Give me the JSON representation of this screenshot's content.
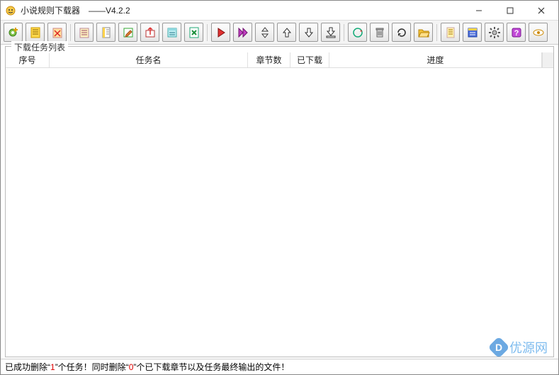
{
  "window": {
    "title": "小说规则下载器　——V4.2.2"
  },
  "group": {
    "title": "下载任务列表"
  },
  "columns": {
    "seq": "序号",
    "name": "任务名",
    "chapters": "章节数",
    "downloaded": "已下载",
    "progress": "进度"
  },
  "status": {
    "p1": "已成功删除“",
    "n1": "1",
    "p2": "”个任务！同时删除“",
    "n2": "0",
    "p3": "”个已下载章节以及任务最终输出的文件！"
  },
  "watermark": "优源网",
  "toolbar_icons": [
    "gear-new",
    "list-yellow",
    "clipboard-red",
    "clipboard-list",
    "notebook",
    "edit-pencil",
    "export-box",
    "notepad-cyan",
    "sheet-x",
    "play",
    "play-double",
    "arrow-both",
    "arrow-up",
    "arrow-down",
    "arrow-down-box",
    "refresh-circle",
    "trash",
    "reload",
    "folder-open",
    "doc-yellow",
    "notepad-blue",
    "settings-gear",
    "help",
    "eye"
  ]
}
